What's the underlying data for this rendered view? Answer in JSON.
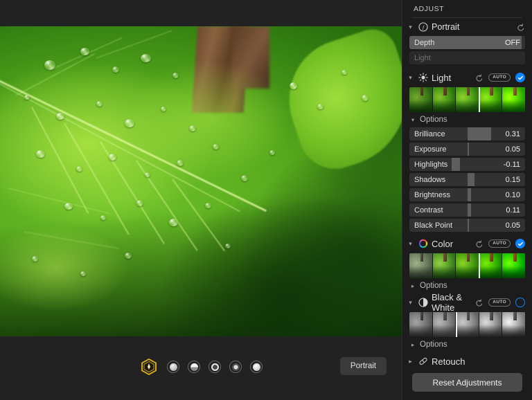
{
  "panel": {
    "title": "ADJUST",
    "reset_adjustments_label": "Reset Adjustments",
    "auto_badge": "AUTO",
    "options_label": "Options",
    "sections": {
      "portrait": {
        "label": "Portrait",
        "icon": "aperture-f-icon",
        "rows": [
          {
            "name": "Depth",
            "value": "OFF",
            "fill_pct": 97,
            "enabled": true
          },
          {
            "name": "Light",
            "value": "",
            "fill_pct": 0,
            "enabled": false
          }
        ]
      },
      "light": {
        "label": "Light",
        "icon": "sun-icon",
        "auto": "AUTO",
        "enabled": true,
        "options_label": "Options",
        "sliders": [
          {
            "name": "Brilliance",
            "value": "0.31",
            "fill_start": 50,
            "fill_end": 70.5
          },
          {
            "name": "Exposure",
            "value": "0.05",
            "fill_start": 50,
            "fill_end": 51.2
          },
          {
            "name": "Highlights",
            "value": "-0.11",
            "fill_start": 36.5,
            "fill_end": 43.5
          },
          {
            "name": "Shadows",
            "value": "0.15",
            "fill_start": 50,
            "fill_end": 56.5
          },
          {
            "name": "Brightness",
            "value": "0.10",
            "fill_start": 50,
            "fill_end": 53.2
          },
          {
            "name": "Contrast",
            "value": "0.11",
            "fill_start": 50,
            "fill_end": 53.5
          },
          {
            "name": "Black Point",
            "value": "0.05",
            "fill_start": 50,
            "fill_end": 51.5
          }
        ]
      },
      "color": {
        "label": "Color",
        "icon": "color-wheel-icon",
        "auto": "AUTO",
        "enabled": true,
        "options_label": "Options"
      },
      "blackwhite": {
        "label": "Black & White",
        "icon": "contrast-circle-icon",
        "auto": "AUTO",
        "enabled": false,
        "options_label": "Options"
      },
      "retouch": {
        "label": "Retouch",
        "icon": "bandage-icon"
      }
    }
  },
  "bottom_bar": {
    "portrait_button_label": "Portrait",
    "lighting_cube_icon": "portrait-lighting-cube-icon",
    "filter_dots": [
      "filter-natural-light",
      "filter-studio-light",
      "filter-contour-light",
      "filter-stage-light",
      "filter-stage-light-mono"
    ]
  },
  "photo": {
    "subject": "green-leaf-with-water-droplets"
  }
}
